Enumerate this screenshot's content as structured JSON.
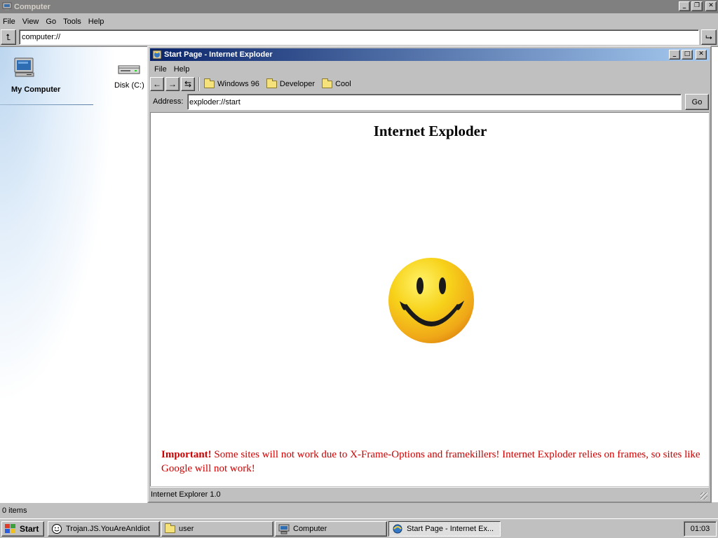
{
  "outer_window": {
    "title": "Computer",
    "menu": [
      "File",
      "View",
      "Go",
      "Tools",
      "Help"
    ],
    "address": "computer://",
    "status": "0 items"
  },
  "sidebar": {
    "title": "My Computer"
  },
  "desktop_items": [
    {
      "label": "Disk (C:)",
      "icon": "hard-disk-icon"
    }
  ],
  "ie_window": {
    "title": "Start Page - Internet Exploder",
    "menu": [
      "File",
      "Help"
    ],
    "favorites": [
      "Windows 96",
      "Developer",
      "Cool"
    ],
    "address_label": "Address:",
    "address": "exploder://start",
    "go_label": "Go",
    "heading": "Internet Exploder",
    "notice_bold": "Important!",
    "notice_text": " Some sites will not work due to X-Frame-Options and framekillers! Internet Exploder relies on frames, so sites like Google will not work!",
    "status": "Internet Explorer 1.0"
  },
  "taskbar": {
    "start_label": "Start",
    "tasks": [
      {
        "label": "Trojan.JS.YouAreAnIdiot",
        "icon": "smiley-icon",
        "active": false
      },
      {
        "label": "user",
        "icon": "folder-icon",
        "active": false
      },
      {
        "label": "Computer",
        "icon": "computer-icon",
        "active": false
      },
      {
        "label": "Start Page - Internet Ex...",
        "icon": "ie-icon",
        "active": true
      }
    ],
    "clock": "01:03"
  },
  "colors": {
    "titlebar_active_start": "#0a246a",
    "titlebar_active_end": "#a6caf0",
    "titlebar_inactive": "#808080",
    "notice_red": "#cc0000",
    "face": "#c0c0c0"
  }
}
